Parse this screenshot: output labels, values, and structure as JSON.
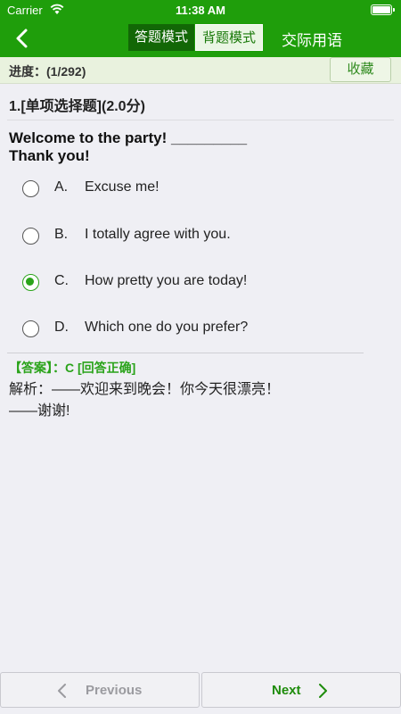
{
  "status_bar": {
    "carrier": "Carrier",
    "time": "11:38 AM"
  },
  "nav": {
    "tabs": [
      {
        "label": "答题模式",
        "active": false
      },
      {
        "label": "背题模式",
        "active": true
      }
    ],
    "title": "交际用语"
  },
  "progress": {
    "label": "进度：(1/292)",
    "favorite_label": "收藏"
  },
  "question": {
    "header": "1.[单项选择题](2.0分)",
    "text_line1": "Welcome to the party! _________",
    "text_line2": "Thank you!",
    "options": [
      {
        "letter": "A.",
        "text": "Excuse me!",
        "selected": false
      },
      {
        "letter": "B.",
        "text": "I totally agree with you.",
        "selected": false
      },
      {
        "letter": "C.",
        "text": "How pretty you are today!",
        "selected": true
      },
      {
        "letter": "D.",
        "text": "Which one do you prefer?",
        "selected": false
      }
    ]
  },
  "answer": {
    "line": "【答案】：C   [回答正确]",
    "analysis_line1": "解析：——欢迎来到晚会！你今天很漂亮！",
    "analysis_line2": "——谢谢!"
  },
  "bottom": {
    "prev_label": "Previous",
    "next_label": "Next"
  },
  "colors": {
    "brand_green": "#1f9e0b",
    "accent_green": "#2aa31a",
    "dark_green_tab": "#126706"
  },
  "icons": {
    "back": "chevron-left-icon",
    "wifi": "wifi-icon",
    "battery": "battery-icon"
  }
}
